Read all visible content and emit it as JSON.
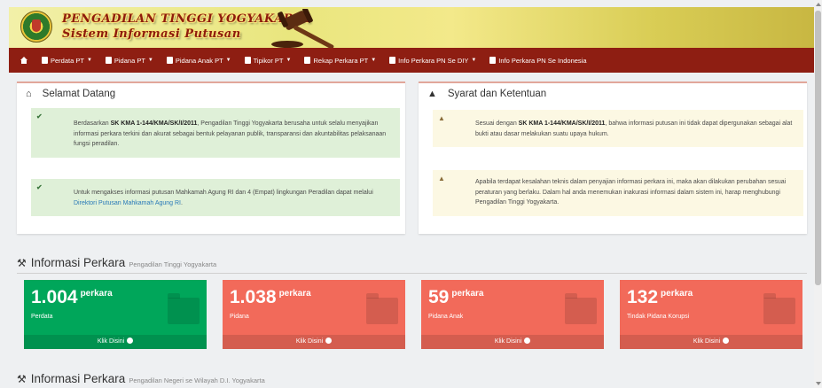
{
  "header": {
    "title_line1": "PENGADILAN TINGGI YOGYAKARTA",
    "title_line2": "Sistem Informasi Putusan"
  },
  "nav": {
    "items": [
      {
        "label": "Perdata PT",
        "dropdown": true
      },
      {
        "label": "Pidana PT",
        "dropdown": true
      },
      {
        "label": "Pidana Anak PT",
        "dropdown": true
      },
      {
        "label": "Tipikor PT",
        "dropdown": true
      },
      {
        "label": "Rekap Perkara PT",
        "dropdown": true
      },
      {
        "label": "Info Perkara PN Se DIY",
        "dropdown": true
      },
      {
        "label": "Info Perkara PN Se Indonesia",
        "dropdown": false
      }
    ],
    "caret": "▼",
    "home_icon": "home-icon"
  },
  "welcome": {
    "title": "Selamat Datang",
    "check": "✔",
    "alert1": {
      "pre": "Berdasarkan ",
      "bold": "SK KMA 1-144/KMA/SK/I/2011",
      "post": ", Pengadilan Tinggi Yogyakarta berusaha untuk selalu menyajikan informasi perkara terkini dan akurat sebagai bentuk pelayanan publik, transparansi dan akuntabilitas pelaksanaan fungsi peradilan."
    },
    "alert2": {
      "pre": "Untuk mengakses informasi putusan Mahkamah Agung RI dan 4 (Empat) lingkungan Peradilan dapat melalui ",
      "link": "Direktori Putusan Mahkamah Agung RI",
      "post": "."
    }
  },
  "terms": {
    "title": "Syarat dan Ketentuan",
    "warn": "▲",
    "alert1": {
      "pre": "Sesuai dengan ",
      "bold": "SK KMA 1-144/KMA/SK/I/2011",
      "post": ", bahwa informasi putusan ini tidak dapat dipergunakan sebagai alat bukti atau dasar melakukan suatu upaya hukum."
    },
    "alert2": "Apabila terdapat kesalahan teknis dalam penyajian informasi perkara ini, maka akan dilakukan perubahan sesuai peraturan yang berlaku. Dalam hal anda menemukan inakurasi informasi dalam sistem ini, harap menghubungi Pengadilan Tinggi Yogyakarta."
  },
  "section1": {
    "title": "Informasi Perkara",
    "subtitle": "Pengadilan Tinggi Yogyakarta"
  },
  "section2": {
    "title": "Informasi Perkara",
    "subtitle": "Pengadilan Negeri se Wilayah D.I. Yogyakarta"
  },
  "stats": [
    {
      "value": "1.004",
      "unit": "perkara",
      "label": "Perdata",
      "link": "Klik Disini",
      "color": "#00a65a"
    },
    {
      "value": "1.038",
      "unit": "perkara",
      "label": "Pidana",
      "link": "Klik Disini",
      "color": "#f26a5a"
    },
    {
      "value": "59",
      "unit": "perkara",
      "label": "Pidana Anak",
      "link": "Klik Disini",
      "color": "#f26a5a"
    },
    {
      "value": "132",
      "unit": "perkara",
      "label": "Tindak Pidana Korupsi",
      "link": "Klik Disini",
      "color": "#f26a5a"
    }
  ],
  "colors": {
    "nav_bg": "#8e1e12",
    "title_text": "#8e1b0c",
    "success_bg": "#dff0d8",
    "warning_bg": "#fcf8e3"
  }
}
